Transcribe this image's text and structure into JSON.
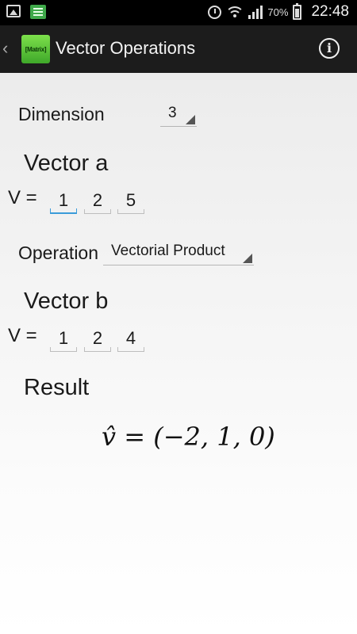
{
  "status_bar": {
    "battery": "70%",
    "time": "22:48",
    "icons": [
      "gallery-icon",
      "list-icon",
      "alarm-icon",
      "wifi-icon",
      "signal-icon",
      "battery-icon"
    ]
  },
  "action_bar": {
    "app_icon_text": "[Matrix]",
    "title": "Vector Operations",
    "info_label": "i"
  },
  "dimension": {
    "label": "Dimension",
    "value": "3"
  },
  "vector_a": {
    "heading": "Vector a",
    "prefix": "V =",
    "values": [
      "1",
      "2",
      "5"
    ]
  },
  "operation": {
    "label": "Operation",
    "value": "Vectorial Product"
  },
  "vector_b": {
    "heading": "Vector b",
    "prefix": "V =",
    "values": [
      "1",
      "2",
      "4"
    ]
  },
  "result": {
    "heading": "Result",
    "formula": "v̂ = (−2, 1, 0)"
  },
  "colors": {
    "focus_accent": "#3a9bd9",
    "app_icon_green": "#5bc53a"
  }
}
